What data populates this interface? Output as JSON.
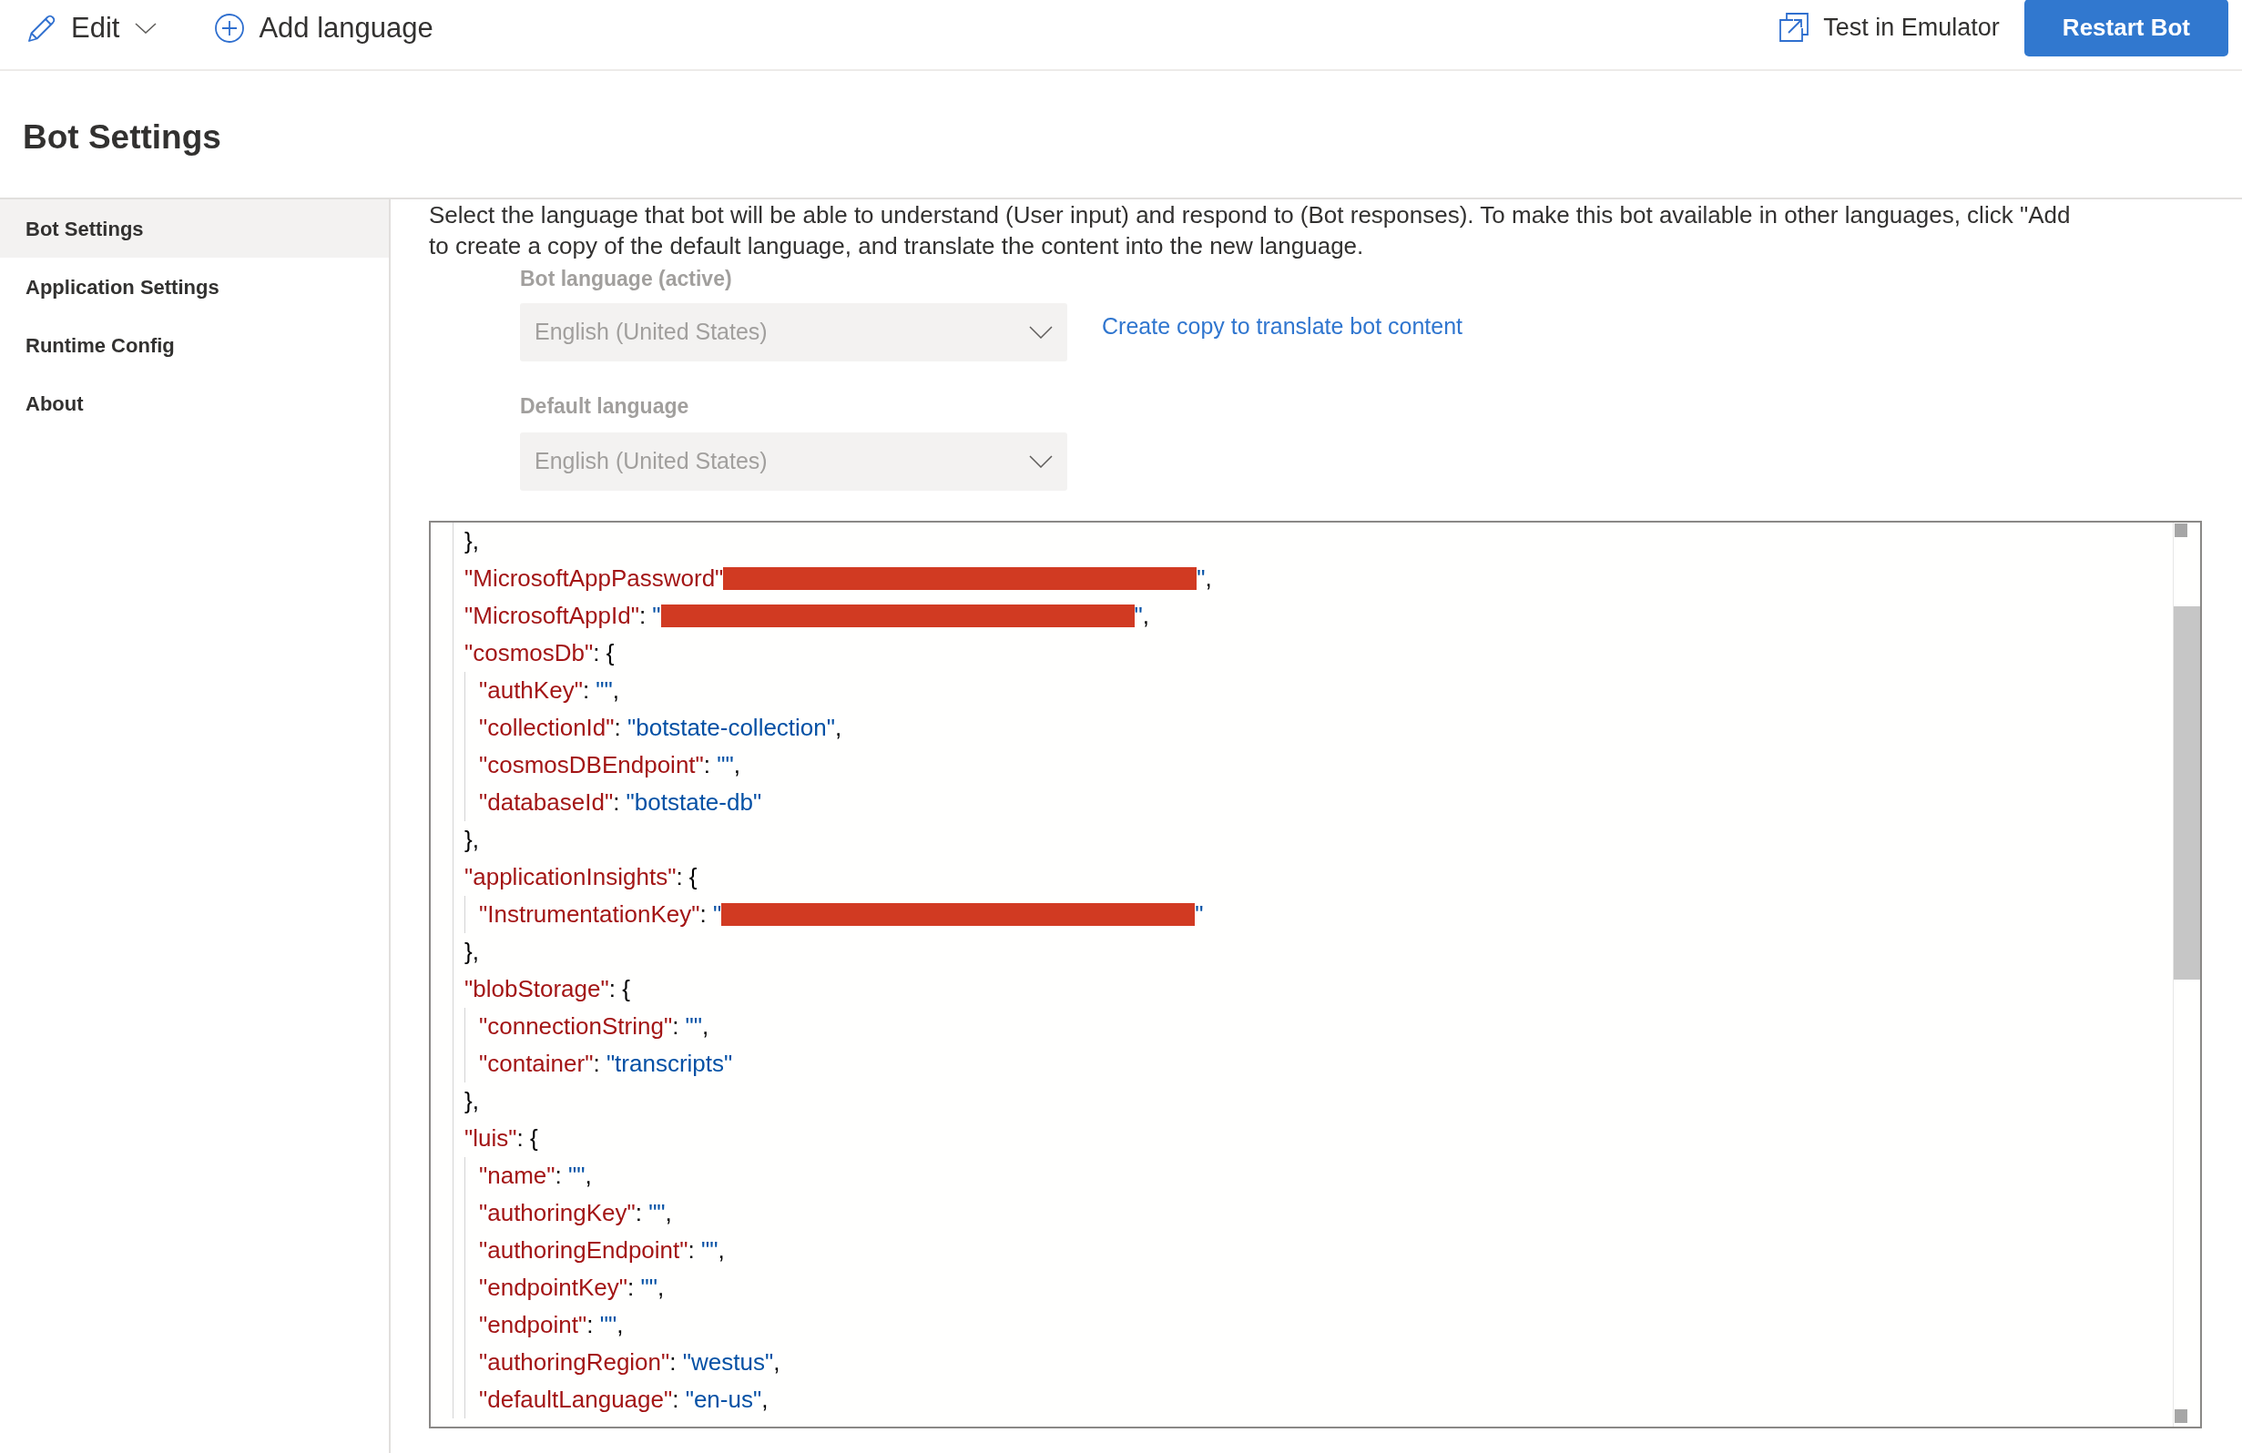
{
  "toolbar": {
    "left": [
      {
        "kind": "menu",
        "label": "Edit"
      },
      {
        "kind": "add",
        "label": "Add language"
      }
    ],
    "right": [
      {
        "kind": "popout",
        "label": "Test in Emulator"
      },
      {
        "kind": "primary",
        "label": "Restart Bot"
      }
    ]
  },
  "page_title": "Bot Settings",
  "sidebar": {
    "items": [
      {
        "label": "Bot Settings",
        "selected": true
      },
      {
        "label": "Application Settings",
        "selected": false
      },
      {
        "label": "Runtime Config",
        "selected": false
      },
      {
        "label": "About",
        "selected": false
      }
    ]
  },
  "description": "Select the language that bot will be able to understand (User input) and respond to (Bot responses). To make this bot available in other languages, click \"Add to create a copy of the default language, and translate the content into the new language.",
  "language_fields": [
    {
      "label": "Bot language (active)",
      "value": "English (United States)",
      "disabled": true,
      "link": "Create copy to translate bot content"
    },
    {
      "label": "Default language",
      "value": "English (United States)",
      "disabled": true
    }
  ],
  "editor": {
    "lines": [
      {
        "tokens": [
          {
            "kind": "punct",
            "text": "},"
          }
        ]
      },
      {
        "tokens": [
          {
            "kind": "key",
            "text": "\"MicrosoftAppPassword\""
          },
          {
            "kind": "redacted"
          },
          {
            "kind": "string",
            "text": "\""
          },
          {
            "kind": "punct",
            "text": ","
          }
        ]
      },
      {
        "tokens": [
          {
            "kind": "key",
            "text": "\"MicrosoftAppId\""
          },
          {
            "kind": "punct",
            "text": ": "
          },
          {
            "kind": "string",
            "text": "\""
          },
          {
            "kind": "redacted"
          },
          {
            "kind": "string",
            "text": "\""
          },
          {
            "kind": "punct",
            "text": ","
          }
        ]
      },
      {
        "tokens": [
          {
            "kind": "key",
            "text": "\"cosmosDb\""
          },
          {
            "kind": "punct",
            "text": ": {"
          }
        ],
        "children": [
          {
            "tokens": [
              {
                "kind": "key",
                "text": "\"authKey\""
              },
              {
                "kind": "punct",
                "text": ": "
              },
              {
                "kind": "string",
                "text": "\"\""
              },
              {
                "kind": "punct",
                "text": ","
              }
            ]
          },
          {
            "tokens": [
              {
                "kind": "key",
                "text": "\"collectionId\""
              },
              {
                "kind": "punct",
                "text": ": "
              },
              {
                "kind": "string",
                "text": "\"botstate-collection\""
              },
              {
                "kind": "punct",
                "text": ","
              }
            ]
          },
          {
            "tokens": [
              {
                "kind": "key",
                "text": "\"cosmosDBEndpoint\""
              },
              {
                "kind": "punct",
                "text": ": "
              },
              {
                "kind": "string",
                "text": "\"\""
              },
              {
                "kind": "punct",
                "text": ","
              }
            ]
          },
          {
            "tokens": [
              {
                "kind": "key",
                "text": "\"databaseId\""
              },
              {
                "kind": "punct",
                "text": ": "
              },
              {
                "kind": "string",
                "text": "\"botstate-db\""
              }
            ]
          }
        ]
      },
      {
        "tokens": [
          {
            "kind": "punct",
            "text": "},"
          }
        ]
      },
      {
        "tokens": [
          {
            "kind": "key",
            "text": "\"applicationInsights\""
          },
          {
            "kind": "punct",
            "text": ": {"
          }
        ],
        "children": [
          {
            "tokens": [
              {
                "kind": "key",
                "text": "\"InstrumentationKey\""
              },
              {
                "kind": "punct",
                "text": ": "
              },
              {
                "kind": "string",
                "text": "\""
              },
              {
                "kind": "redacted"
              },
              {
                "kind": "string",
                "text": "\""
              }
            ]
          }
        ]
      },
      {
        "tokens": [
          {
            "kind": "punct",
            "text": "},"
          }
        ]
      },
      {
        "tokens": [
          {
            "kind": "key",
            "text": "\"blobStorage\""
          },
          {
            "kind": "punct",
            "text": ": {"
          }
        ],
        "children": [
          {
            "tokens": [
              {
                "kind": "key",
                "text": "\"connectionString\""
              },
              {
                "kind": "punct",
                "text": ": "
              },
              {
                "kind": "string",
                "text": "\"\""
              },
              {
                "kind": "punct",
                "text": ","
              }
            ]
          },
          {
            "tokens": [
              {
                "kind": "key",
                "text": "\"container\""
              },
              {
                "kind": "punct",
                "text": ": "
              },
              {
                "kind": "string",
                "text": "\"transcripts\""
              }
            ]
          }
        ]
      },
      {
        "tokens": [
          {
            "kind": "punct",
            "text": "},"
          }
        ]
      },
      {
        "tokens": [
          {
            "kind": "key",
            "text": "\"luis\""
          },
          {
            "kind": "punct",
            "text": ": {"
          }
        ],
        "children": [
          {
            "tokens": [
              {
                "kind": "key",
                "text": "\"name\""
              },
              {
                "kind": "punct",
                "text": ": "
              },
              {
                "kind": "string",
                "text": "\"\""
              },
              {
                "kind": "punct",
                "text": ","
              }
            ]
          },
          {
            "tokens": [
              {
                "kind": "key",
                "text": "\"authoringKey\""
              },
              {
                "kind": "punct",
                "text": ": "
              },
              {
                "kind": "string",
                "text": "\"\""
              },
              {
                "kind": "punct",
                "text": ","
              }
            ]
          },
          {
            "tokens": [
              {
                "kind": "key",
                "text": "\"authoringEndpoint\""
              },
              {
                "kind": "punct",
                "text": ": "
              },
              {
                "kind": "string",
                "text": "\"\""
              },
              {
                "kind": "punct",
                "text": ","
              }
            ]
          },
          {
            "tokens": [
              {
                "kind": "key",
                "text": "\"endpointKey\""
              },
              {
                "kind": "punct",
                "text": ": "
              },
              {
                "kind": "string",
                "text": "\"\""
              },
              {
                "kind": "punct",
                "text": ","
              }
            ]
          },
          {
            "tokens": [
              {
                "kind": "key",
                "text": "\"endpoint\""
              },
              {
                "kind": "punct",
                "text": ": "
              },
              {
                "kind": "string",
                "text": "\"\""
              },
              {
                "kind": "punct",
                "text": ","
              }
            ]
          },
          {
            "tokens": [
              {
                "kind": "key",
                "text": "\"authoringRegion\""
              },
              {
                "kind": "punct",
                "text": ": "
              },
              {
                "kind": "string",
                "text": "\"westus\""
              },
              {
                "kind": "punct",
                "text": ","
              }
            ]
          },
          {
            "tokens": [
              {
                "kind": "key",
                "text": "\"defaultLanguage\""
              },
              {
                "kind": "punct",
                "text": ": "
              },
              {
                "kind": "string",
                "text": "\"en-us\""
              },
              {
                "kind": "punct",
                "text": ","
              }
            ]
          }
        ]
      }
    ]
  }
}
